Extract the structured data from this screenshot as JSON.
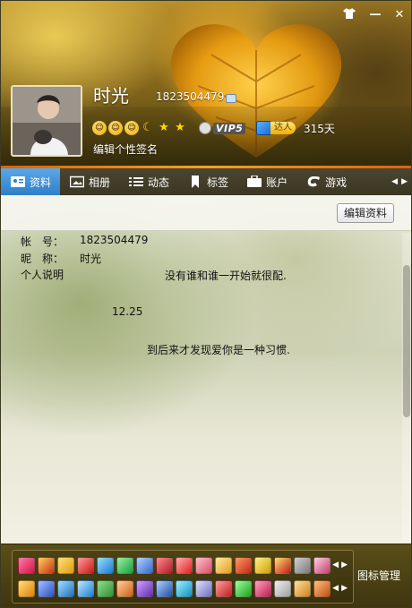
{
  "window": {
    "skin_icon": "shirt-icon",
    "minimize_label": "—",
    "close_label": "✕"
  },
  "profile": {
    "nickname": "时光",
    "qq_number": "1823504479",
    "signature_link": "编辑个性签名",
    "vip_label": "VIP5",
    "daren_label": "达人",
    "days": "315天"
  },
  "tabs": [
    {
      "label": "资料",
      "icon": "id-card-icon",
      "active": true
    },
    {
      "label": "相册",
      "icon": "photo-album-icon",
      "active": false
    },
    {
      "label": "动态",
      "icon": "list-icon",
      "active": false
    },
    {
      "label": "标签",
      "icon": "bookmark-icon",
      "active": false
    },
    {
      "label": "账户",
      "icon": "wallet-icon",
      "active": false
    },
    {
      "label": "游戏",
      "icon": "game-icon",
      "active": false
    }
  ],
  "content": {
    "edit_button": "编辑资料",
    "account_label": "帐　号：",
    "account_value": "1823504479",
    "nickname_label": "昵　称：",
    "nickname_value": "时光",
    "bio_label": "个人说明",
    "bio_line1": "没有谁和谁一开始就很配.",
    "bio_line2": "12.25",
    "bio_line3": "到后来才发现爱你是一种习惯."
  },
  "bottom_bar": {
    "manage_label": "图标管理",
    "row1_count": 17,
    "row2_count": 17
  },
  "colors": {
    "tab_active": "#3a8fd6",
    "accent_orange": "#e8700a"
  }
}
